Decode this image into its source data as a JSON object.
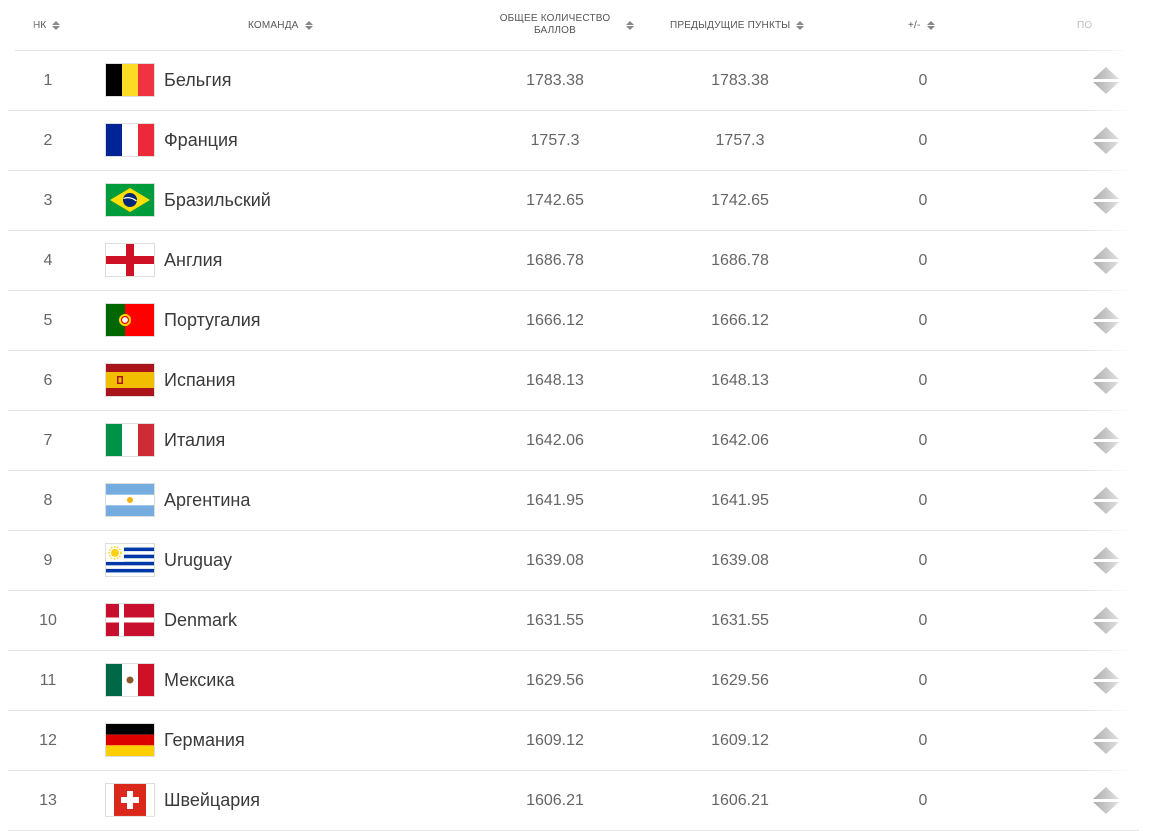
{
  "header": {
    "rank": "НК",
    "team": "КОМАНДА",
    "total": "ОБЩЕЕ КОЛИЧЕСТВО БАЛЛОВ",
    "previous": "ПРЕДЫДУЩИЕ ПУНКТЫ",
    "diff": "+/-",
    "position": "ПО"
  },
  "rows": [
    {
      "rank": "1",
      "team": "Бельгия",
      "total": "1783.38",
      "previous": "1783.38",
      "diff": "0",
      "flag": "belgium-flag-icon"
    },
    {
      "rank": "2",
      "team": "Франция",
      "total": "1757.3",
      "previous": "1757.3",
      "diff": "0",
      "flag": "france-flag-icon"
    },
    {
      "rank": "3",
      "team": "Бразильский",
      "total": "1742.65",
      "previous": "1742.65",
      "diff": "0",
      "flag": "brazil-flag-icon"
    },
    {
      "rank": "4",
      "team": "Англия",
      "total": "1686.78",
      "previous": "1686.78",
      "diff": "0",
      "flag": "england-flag-icon"
    },
    {
      "rank": "5",
      "team": "Португалия",
      "total": "1666.12",
      "previous": "1666.12",
      "diff": "0",
      "flag": "portugal-flag-icon"
    },
    {
      "rank": "6",
      "team": "Испания",
      "total": "1648.13",
      "previous": "1648.13",
      "diff": "0",
      "flag": "spain-flag-icon"
    },
    {
      "rank": "7",
      "team": "Италия",
      "total": "1642.06",
      "previous": "1642.06",
      "diff": "0",
      "flag": "italy-flag-icon"
    },
    {
      "rank": "8",
      "team": "Аргентина",
      "total": "1641.95",
      "previous": "1641.95",
      "diff": "0",
      "flag": "argentina-flag-icon"
    },
    {
      "rank": "9",
      "team": "Uruguay",
      "total": "1639.08",
      "previous": "1639.08",
      "diff": "0",
      "flag": "uruguay-flag-icon"
    },
    {
      "rank": "10",
      "team": "Denmark",
      "total": "1631.55",
      "previous": "1631.55",
      "diff": "0",
      "flag": "denmark-flag-icon"
    },
    {
      "rank": "11",
      "team": "Мексика",
      "total": "1629.56",
      "previous": "1629.56",
      "diff": "0",
      "flag": "mexico-flag-icon"
    },
    {
      "rank": "12",
      "team": "Германия",
      "total": "1609.12",
      "previous": "1609.12",
      "diff": "0",
      "flag": "germany-flag-icon"
    },
    {
      "rank": "13",
      "team": "Швейцария",
      "total": "1606.21",
      "previous": "1606.21",
      "diff": "0",
      "flag": "switzerland-flag-icon"
    }
  ]
}
